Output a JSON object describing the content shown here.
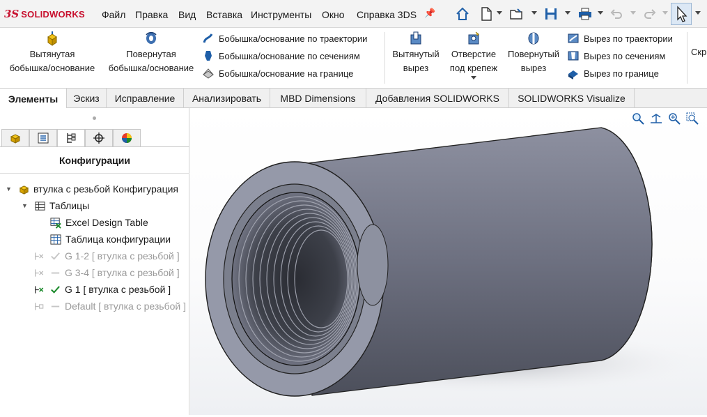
{
  "app": {
    "logo_mark": "3S",
    "logo_text": "SOLIDWORKS"
  },
  "menu": [
    "Файл",
    "Правка",
    "Вид",
    "Вставка",
    "Инструменты",
    "Окно",
    "Справка 3DS"
  ],
  "quick_access": [
    "home-icon",
    "new-document-icon",
    "open-folder-icon",
    "save-icon",
    "print-icon",
    "undo-icon",
    "redo-icon",
    "select-cursor-icon"
  ],
  "ribbon": {
    "extruded_boss": [
      "Вытянутая",
      "бобышка/основание"
    ],
    "revolved_boss": [
      "Повернутая",
      "бобышка/основание"
    ],
    "boss_group": [
      "Бобышка/основание по траектории",
      "Бобышка/основание по сечениям",
      "Бобышка/основание на границе"
    ],
    "extruded_cut": [
      "Вытянутый",
      "вырез"
    ],
    "hole_wizard": [
      "Отверстие",
      "под крепеж"
    ],
    "revolved_cut": [
      "Повернутый",
      "вырез"
    ],
    "cut_group": [
      "Вырез по траектории",
      "Вырез по сечениям",
      "Вырез по границе"
    ],
    "overflow": "Скр"
  },
  "tabs": [
    "Элементы",
    "Эскиз",
    "Исправление",
    "Анализировать",
    "MBD Dimensions",
    "Добавления SOLIDWORKS",
    "SOLIDWORKS Visualize"
  ],
  "panel": {
    "tabs": [
      "feature-manager-icon",
      "property-manager-icon",
      "configuration-manager-icon",
      "dim-xpert-icon",
      "display-manager-icon"
    ],
    "title": "Конфигурации",
    "root": "втулка с резьбой Конфигурация",
    "tables": "Таблицы",
    "excel_table": "Excel Design Table",
    "config_table": "Таблица конфигурации",
    "configs": [
      {
        "label": "G 1-2 [ втулка с резьбой ]",
        "active": false
      },
      {
        "label": "G 3-4 [ втулка с резьбой ]",
        "active": false
      },
      {
        "label": "G 1 [ втулка с резьбой ]",
        "active": true
      },
      {
        "label": "Default [ втулка с резьбой ]",
        "active": false
      }
    ]
  },
  "colors": {
    "accent": "#c8102e",
    "model_body": "#6e7280",
    "model_face": "#8e92a3",
    "active_check": "#1b8a2b"
  }
}
